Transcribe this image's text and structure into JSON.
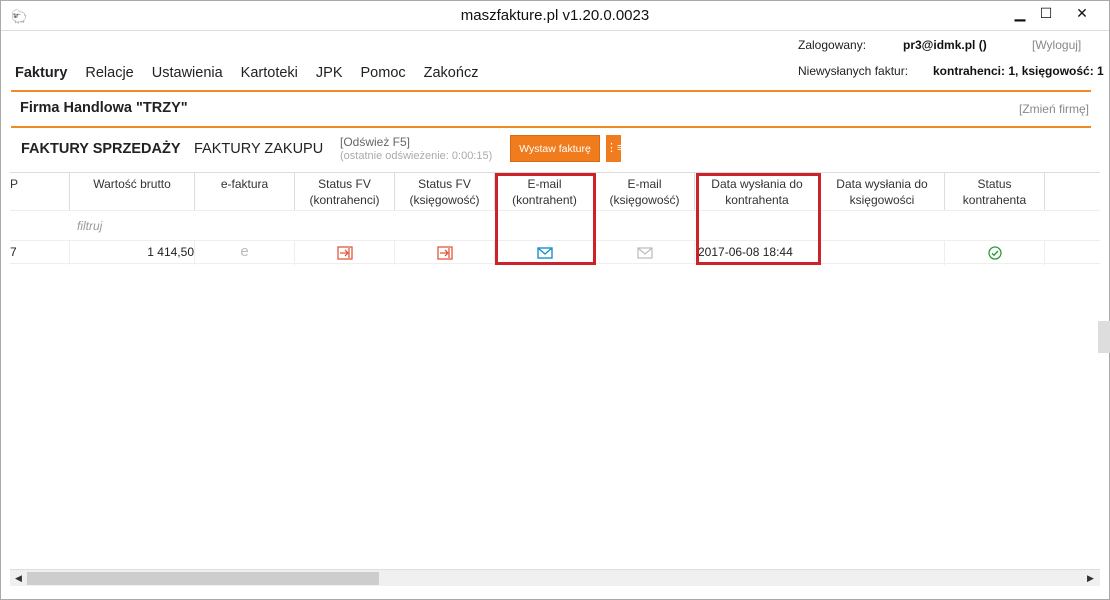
{
  "window": {
    "title": "maszfakture.pl  v1.20.0.0023",
    "minimize": "▁",
    "maximize": "☐",
    "close": "✕",
    "app_icon": "🐑"
  },
  "menu": {
    "items": [
      "Faktury",
      "Relacje",
      "Ustawienia",
      "Kartoteki",
      "JPK",
      "Pomoc",
      "Zakończ"
    ]
  },
  "session": {
    "logged_label": "Zalogowany:",
    "user": "pr3@idmk.pl ()",
    "logout": "[Wyloguj]",
    "unsent_label": "Niewysłanych faktur:",
    "unsent_value": "kontrahenci: 1, księgowość: 1"
  },
  "company": {
    "name": "Firma Handlowa \"TRZY\"",
    "change": "[Zmień firmę]"
  },
  "tabs": {
    "sales": "FAKTURY SPRZEDAŻY",
    "purchase": "FAKTURY ZAKUPU",
    "refresh": "[Odśwież F5]",
    "refresh_sub": "(ostatnie odświeżenie: 0:00:15)",
    "issue": "Wystaw fakturę",
    "issue_menu": "⋮≡"
  },
  "grid": {
    "columns": [
      "P",
      "Wartość brutto",
      "e-faktura",
      "Status FV (kontrahenci)",
      "Status FV (księgowość)",
      "E-mail (kontrahent)",
      "E-mail (księgowość)",
      "Data wysłania do kontrahenta",
      "Data wysłania do księgowości",
      "Status kontrahenta"
    ],
    "filter": "filtruj",
    "rows": [
      {
        "p": "7",
        "gross": "1 414,50",
        "efaktura": "e",
        "sent_date": "2017-06-08 18:44",
        "sent_acc": ""
      }
    ]
  },
  "colors": {
    "accent": "#f07c1e",
    "highlight": "#cc2229",
    "status_ok": "#2a9d3a",
    "mail_active": "#1a8fd0"
  }
}
